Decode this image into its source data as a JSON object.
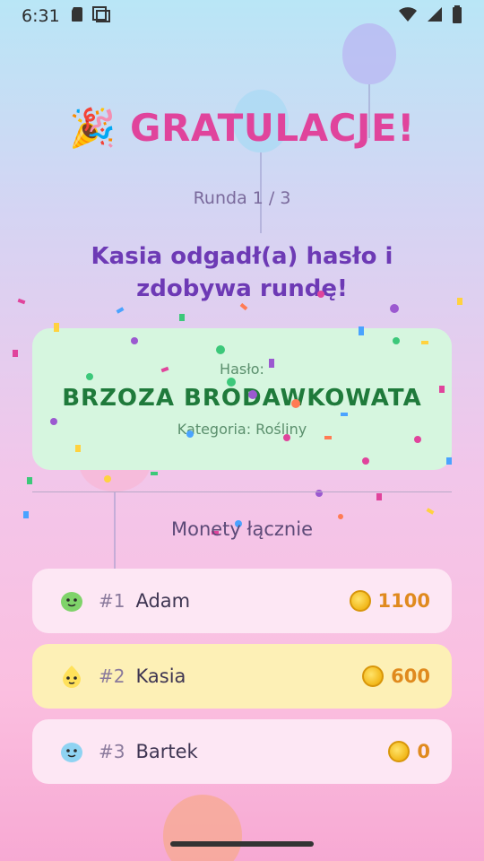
{
  "status_bar": {
    "time": "6:31",
    "icons_left": [
      "sd-card-icon",
      "screenshot-icon"
    ],
    "icons_right": [
      "wifi-icon",
      "signal-icon",
      "battery-icon"
    ]
  },
  "header": {
    "emoji": "🎉",
    "title": "GRATULACJE!",
    "round_label": "Runda 1 / 3"
  },
  "result": {
    "message": "Kasia odgadł(a) hasło i zdobywa rundę!"
  },
  "password_card": {
    "label": "Hasło:",
    "word": "BRZOZA BRODAWKOWATA",
    "category": "Kategoria: Rośliny"
  },
  "coins": {
    "header": "Monety łącznie",
    "players": [
      {
        "rank": "#1",
        "name": "Adam",
        "coins": "1100",
        "avatar": "green-blob-avatar-icon",
        "highlight": false
      },
      {
        "rank": "#2",
        "name": "Kasia",
        "coins": "600",
        "avatar": "yellow-blob-avatar-icon",
        "highlight": true
      },
      {
        "rank": "#3",
        "name": "Bartek",
        "coins": "0",
        "avatar": "blue-blob-avatar-icon",
        "highlight": false
      }
    ]
  },
  "colors": {
    "title": "#e0449c",
    "winner_text": "#6d3ab5",
    "password_word": "#1f7a3b",
    "coin_value": "#e08a1e"
  }
}
